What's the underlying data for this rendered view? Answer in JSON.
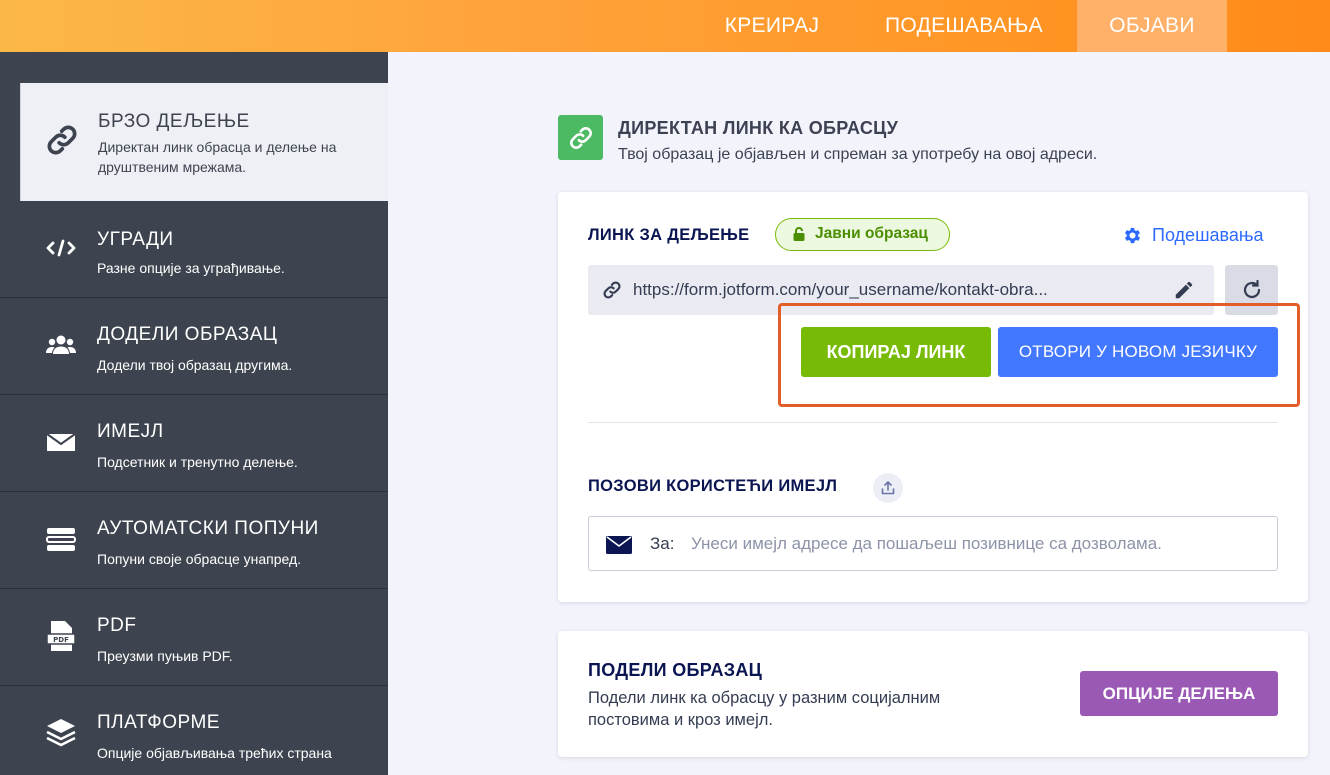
{
  "topbar": {
    "tabs": [
      {
        "label": "КРЕИРАЈ"
      },
      {
        "label": "ПОДЕШАВАЊА"
      },
      {
        "label": "ОБЈАВИ"
      }
    ]
  },
  "sidebar": {
    "items": [
      {
        "title": "БРЗО ДЕЉЕЊЕ",
        "desc": "Директан линк обрасца и делење на друштвеним мрежама.",
        "icon": "link-icon"
      },
      {
        "title": "УГРАДИ",
        "desc": "Разне опције за уграђивање.",
        "icon": "code-icon"
      },
      {
        "title": "ДОДЕЛИ ОБРАЗАЦ",
        "desc": "Додели твој образац другима.",
        "icon": "users-icon"
      },
      {
        "title": "ИМЕЈЛ",
        "desc": "Подсетник и тренутно делење.",
        "icon": "envelope-icon"
      },
      {
        "title": "АУТОМАТСКИ ПОПУНИ",
        "desc": "Попуни своје обрасце унапред.",
        "icon": "list-icon"
      },
      {
        "title": "PDF",
        "desc": "Преузми пуњив PDF.",
        "icon": "pdf-icon"
      },
      {
        "title": "ПЛАТФОРМЕ",
        "desc": "Опције објављивања трећих страна",
        "icon": "layers-icon"
      }
    ]
  },
  "main": {
    "header": {
      "title": "ДИРЕКТАН ЛИНК КА ОБРАСЦУ",
      "subtitle": "Твој образац је објављен и спреман за употребу на овој адреси."
    },
    "share_link": {
      "label": "ЛИНК ЗА ДЕЉЕЊЕ",
      "badge": "Јавни образац",
      "settings_label": "Подешавања",
      "url": "https://form.jotform.com/your_username/kontakt-obra...",
      "copy_button": "КОПИРАЈ ЛИНК",
      "open_button": "ОТВОРИ У НОВОМ ЈЕЗИЧКУ"
    },
    "invite": {
      "label": "ПОЗОВИ КОРИСТЕЋИ ИМЕЈЛ",
      "to_label": "За:",
      "placeholder": "Унеси имејл адресе да пошаљеш позивнице са дозволама."
    },
    "share_form": {
      "title": "ПОДЕЛИ ОБРАЗАЦ",
      "desc": "Подели линк ка обрасцу у разним социјалним постовима и кроз имејл.",
      "button": "ОПЦИЈЕ ДЕЛЕЊА"
    }
  },
  "colors": {
    "accent_green": "#78bb07",
    "accent_blue": "#4277ff",
    "accent_purple": "#9b59b6",
    "highlight": "#e35d28",
    "sidebar_bg": "#3e444f"
  }
}
